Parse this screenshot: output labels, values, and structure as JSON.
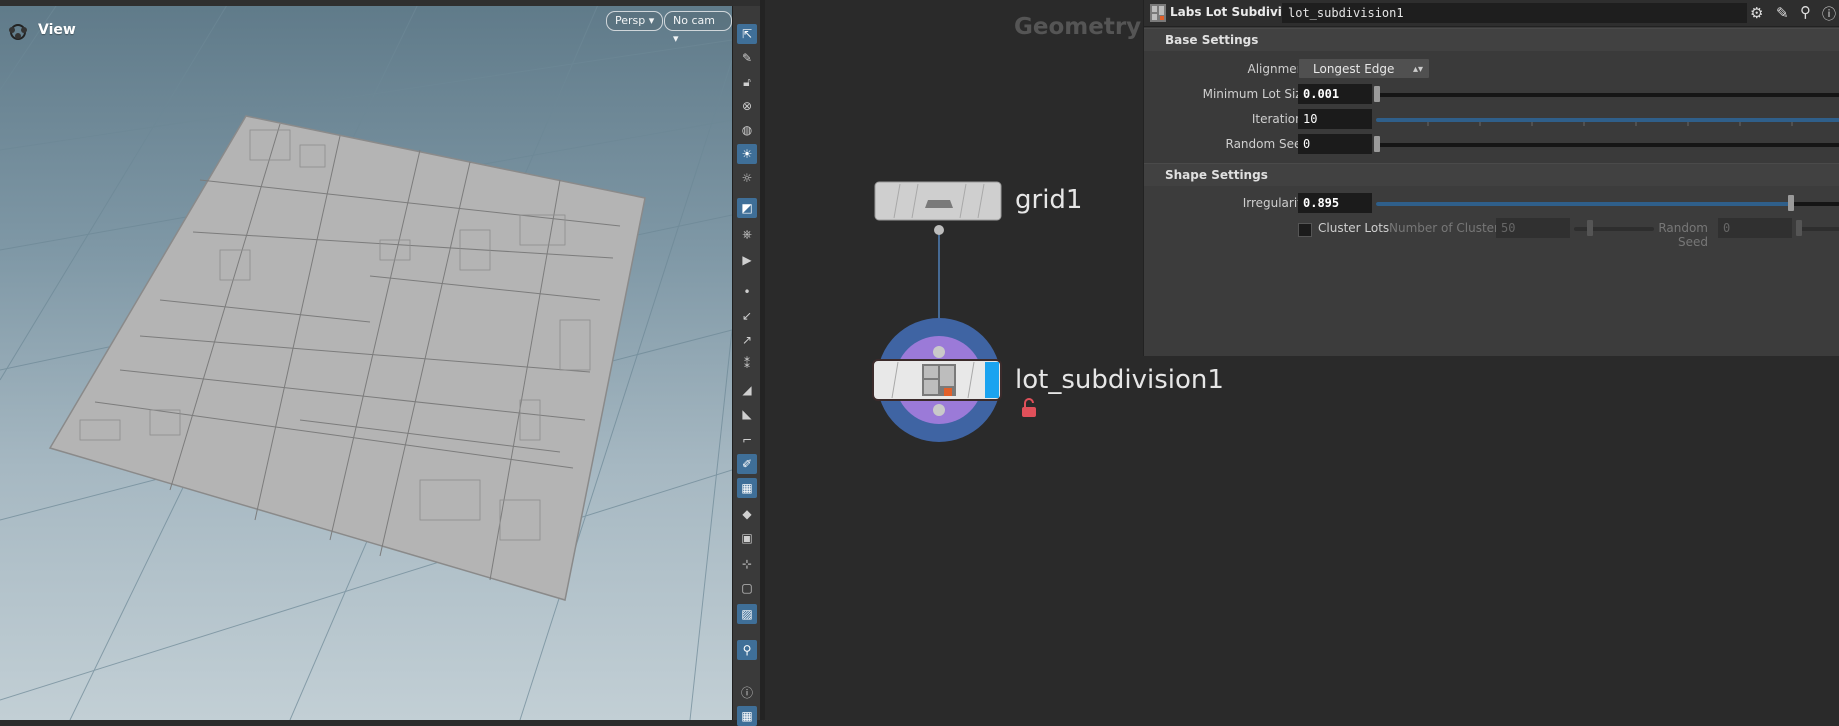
{
  "viewport": {
    "title": "View",
    "camera_mode": "Persp",
    "camera": "No cam"
  },
  "network": {
    "context_label": "Geometry",
    "nodes": [
      {
        "name": "grid1",
        "type": "grid"
      },
      {
        "name": "lot_subdivision1",
        "type": "lot subdivision"
      }
    ]
  },
  "params": {
    "node_type": "Labs Lot Subdivision",
    "node_name": "lot_subdivision1",
    "sections": {
      "base": "Base Settings",
      "shape": "Shape Settings"
    },
    "alignment": {
      "label": "Alignment",
      "value": "Longest Edge"
    },
    "min_lot_size": {
      "label": "Minimum Lot Size",
      "value": "0.001"
    },
    "iterations": {
      "label": "Iterations",
      "value": "10"
    },
    "random_seed": {
      "label": "Random Seed",
      "value": "0"
    },
    "irregularity": {
      "label": "Irregularity",
      "value": "0.895",
      "slider_fraction": 0.895
    },
    "cluster_lots": {
      "label": "Cluster Lots",
      "checked": false
    },
    "num_clusters": {
      "label": "Number of Clusters",
      "value": "50"
    },
    "cluster_seed": {
      "label": "Random Seed",
      "value": "0"
    }
  },
  "colors": {
    "accent": "#3f6f98",
    "node_ring_outer": "#3f64a3",
    "node_ring_inner": "#9b7ad8",
    "display_flag": "#1aa3f0",
    "lock": "#e0505a"
  }
}
